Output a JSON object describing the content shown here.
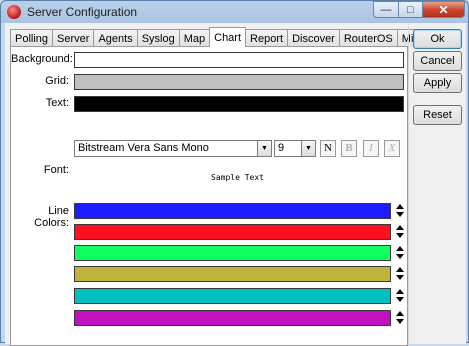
{
  "window": {
    "title": "Server Configuration",
    "controls": {
      "minimize": "—",
      "maximize": "□",
      "close": "✕"
    }
  },
  "tabs": [
    "Polling",
    "Server",
    "Agents",
    "Syslog",
    "Map",
    "Chart",
    "Report",
    "Discover",
    "RouterOS",
    "Misc",
    "..."
  ],
  "active_tab": "Chart",
  "chart_settings": {
    "background_label": "Background:",
    "background_color": "#ffffff",
    "grid_label": "Grid:",
    "grid_color": "#c0c0c0",
    "text_label": "Text:",
    "text_color": "#000000",
    "font_label": "Font:",
    "font_name": "Bitstream Vera Sans Mono",
    "font_size": "9",
    "format_buttons": {
      "normal": "N",
      "bold": "B",
      "italic": "I",
      "strike": "X"
    },
    "sample_text": "Sample Text",
    "line_colors_label": "Line Colors:",
    "line_colors": [
      "#1c1cff",
      "#ff1020",
      "#10ff60",
      "#c0b43c",
      "#00c0c0",
      "#c010c0"
    ]
  },
  "buttons": {
    "ok": "Ok",
    "cancel": "Cancel",
    "apply": "Apply",
    "reset": "Reset"
  }
}
